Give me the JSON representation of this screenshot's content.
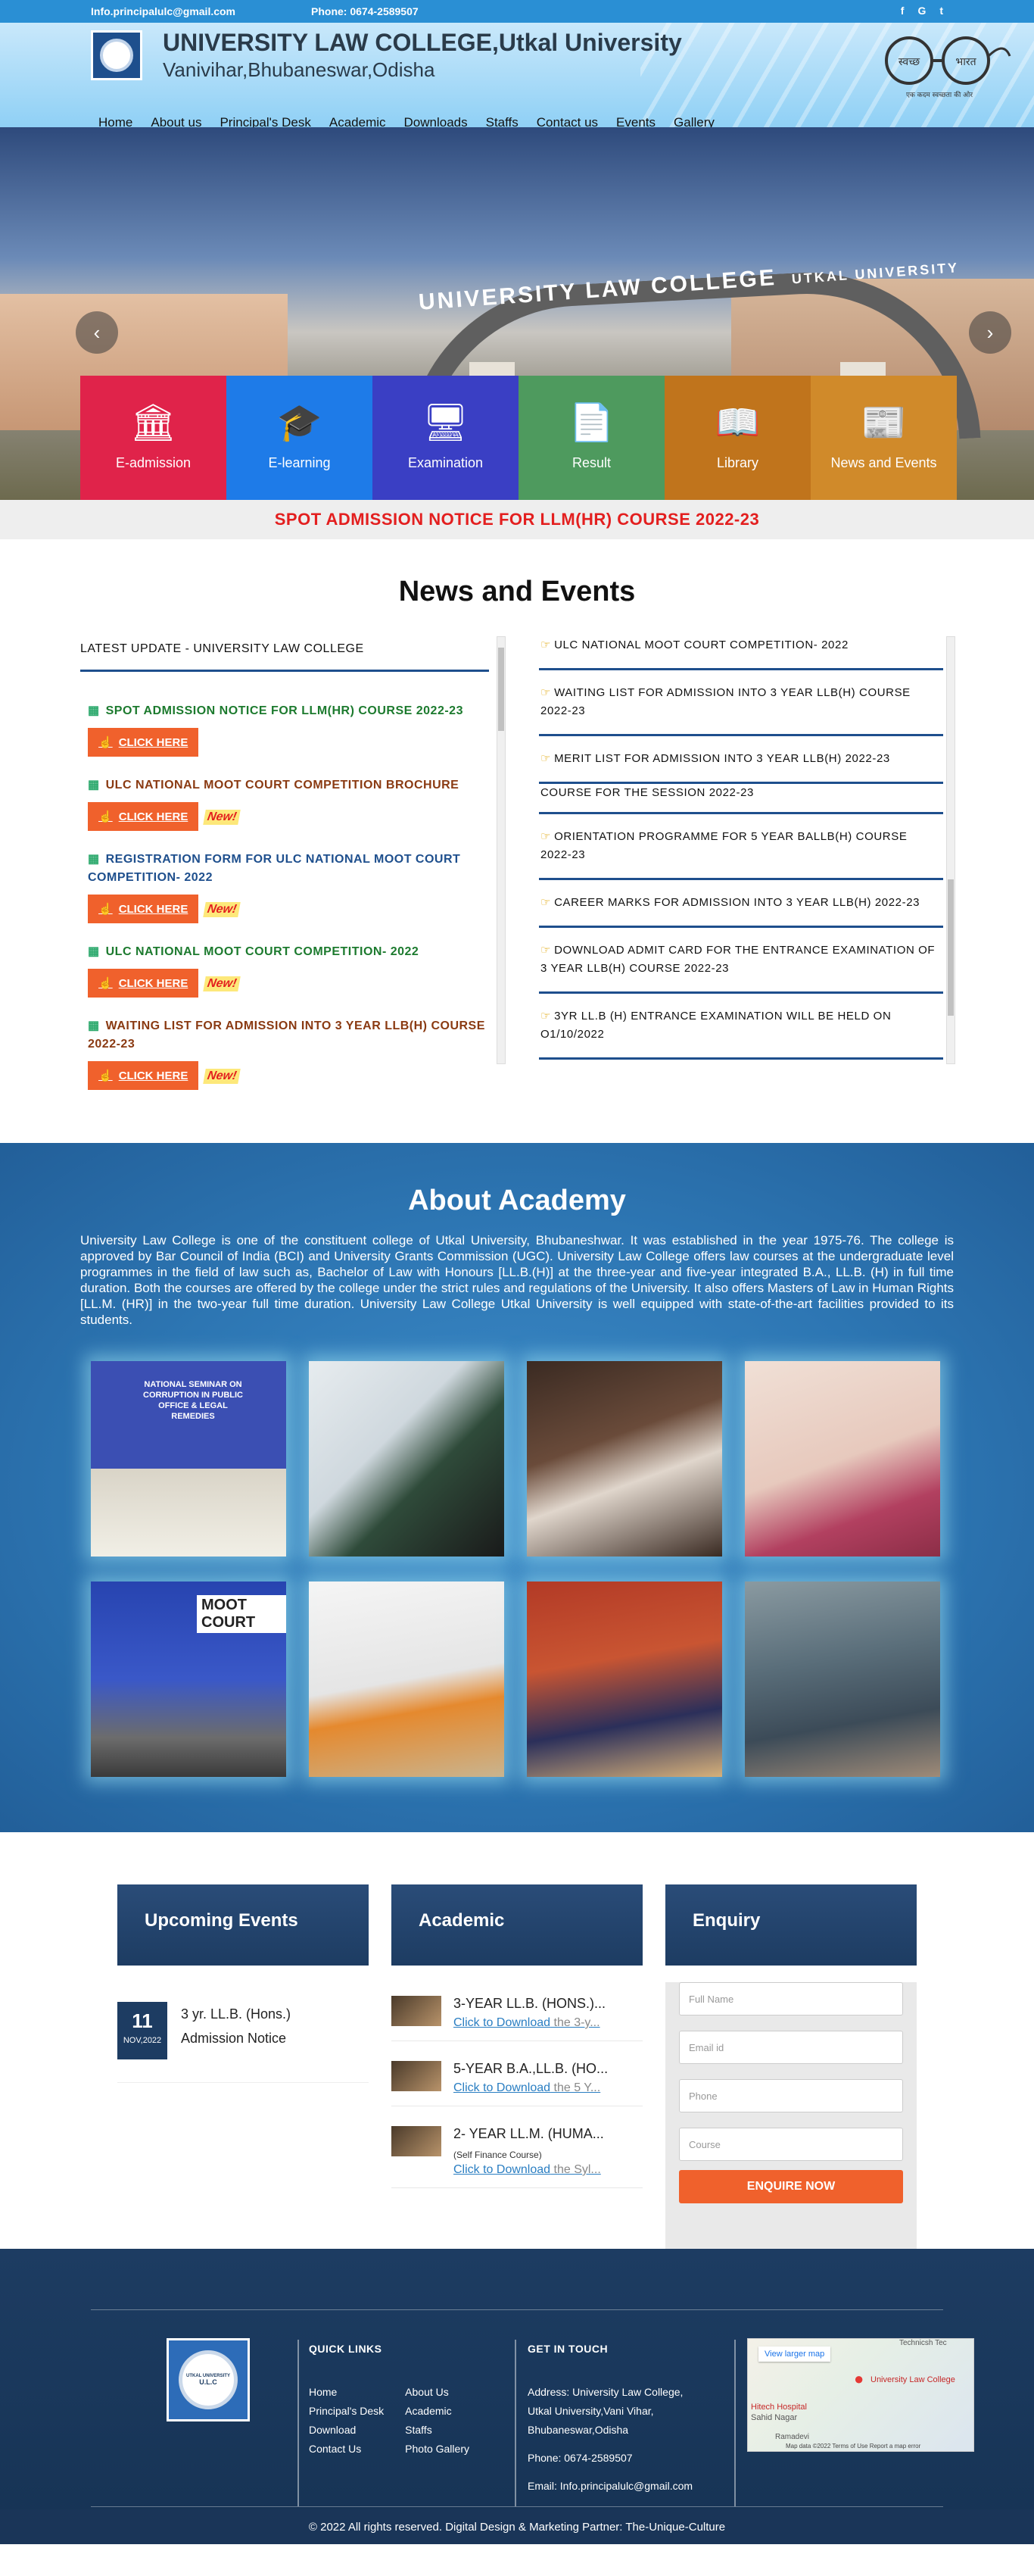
{
  "topbar": {
    "email": "Info.principalulc@gmail.com",
    "phone": "Phone: 0674-2589507",
    "social": [
      "f",
      "G",
      "t"
    ]
  },
  "header": {
    "title": "UNIVERSITY LAW COLLEGE,Utkal University",
    "subtitle": "Vanivihar,Bhubaneswar,Odisha",
    "swachh_text": [
      "स्वच्छ",
      "भारत",
      "एक कदम स्वच्छता की ओर"
    ],
    "nav": [
      "Home",
      "About us",
      "Principal's Desk",
      "Academic",
      "Downloads",
      "Staffs",
      "Contact us",
      "Events",
      "Gallery"
    ]
  },
  "hero": {
    "arch_text": "UNIVERSITY LAW COLLEGE",
    "arch_sub": "UTKAL UNIVERSITY",
    "tiles": [
      {
        "label": "E-admission",
        "icon": "bank-icon",
        "color": "#e0234a"
      },
      {
        "label": "E-learning",
        "icon": "graduation-cap-icon",
        "color": "#1e7be8"
      },
      {
        "label": "Examination",
        "icon": "monitor-icon",
        "color": "#3a3fc4"
      },
      {
        "label": "Result",
        "icon": "document-icon",
        "color": "#4e9a5e"
      },
      {
        "label": "Library",
        "icon": "book-icon",
        "color": "#c0741c"
      },
      {
        "label": "News and Events",
        "icon": "newspaper-icon",
        "color": "#d08a2a"
      }
    ]
  },
  "notice": "SPOT ADMISSION NOTICE FOR LLM(HR) COURSE 2022-23",
  "news": {
    "heading": "News and Events",
    "latest_label": "LATEST UPDATE - UNIVERSITY LAW COLLEGE",
    "click": "CLICK HERE",
    "new_badge": "New!",
    "left_items": [
      {
        "title": "SPOT ADMISSION NOTICE FOR LLM(HR) COURSE 2022-23",
        "color": "#1c7a2e",
        "new": false
      },
      {
        "title": "ULC NATIONAL MOOT COURT COMPETITION BROCHURE",
        "color": "#8a3a12",
        "new": true
      },
      {
        "title": "REGISTRATION FORM FOR ULC NATIONAL MOOT COURT COMPETITION- 2022",
        "color": "#1e4f8d",
        "new": true
      },
      {
        "title": "ULC NATIONAL MOOT COURT COMPETITION- 2022",
        "color": "#1c7a2e",
        "new": true
      },
      {
        "title": "WAITING LIST FOR ADMISSION INTO 3 YEAR LLB(H) COURSE 2022-23",
        "color": "#8a3a12",
        "new": true
      }
    ],
    "right_items": [
      "ULC NATIONAL MOOT COURT COMPETITION- 2022",
      "WAITING LIST FOR ADMISSION INTO 3 YEAR LLB(H) COURSE 2022-23",
      "MERIT LIST FOR ADMISSION INTO 3 YEAR LLB(H) 2022-23",
      "COURSE FOR THE SESSION 2022-23",
      "ORIENTATION PROGRAMME FOR 5 YEAR BALLB(H) COURSE 2022-23",
      "CAREER MARKS FOR ADMISSION INTO 3 YEAR LLB(H) 2022-23",
      "DOWNLOAD ADMIT CARD FOR THE ENTRANCE EXAMINATION OF 3 YEAR LLB(H) COURSE 2022-23",
      "3YR LL.B (H) ENTRANCE EXAMINATION WILL BE HELD ON O1/10/2022"
    ]
  },
  "about": {
    "heading": "About Academy",
    "text": "University Law College is one of the constituent college of Utkal University, Bhubaneshwar. It was established in the year 1975-76. The college is approved by Bar Council of India (BCI) and University Grants Commission (UGC). University Law College offers law courses at the undergraduate level programmes in the field of law such as, Bachelor of Law with Honours [LL.B.(H)] at the three-year and five-year integrated B.A., LL.B. (H) in full time duration. Both the courses are offered by the college under the strict rules and regulations of the University. It also offers Masters of Law in Human Rights [LL.M. (HR)] in the two-year full time duration. University Law College Utkal University is well equipped with state-of-the-art facilities provided to its students.",
    "photos": [
      {
        "caption": "NATIONAL SEMINAR ON CORRUPTION IN PUBLIC OFFICE & LEGAL REMEDIES"
      },
      {
        "caption": ""
      },
      {
        "caption": ""
      },
      {
        "caption": ""
      },
      {
        "caption": "MOOT COURT"
      },
      {
        "caption": ""
      },
      {
        "caption": ""
      },
      {
        "caption": ""
      }
    ]
  },
  "events": {
    "heading": "Upcoming Events",
    "day": "11",
    "month": "NOV,2022",
    "line1": "3 yr. LL.B. (Hons.)",
    "line2": "Admission Notice"
  },
  "academic": {
    "heading": "Academic",
    "link_text": "Click to  Download",
    "items": [
      {
        "title": "3-YEAR LL.B. (HONS.)...",
        "sub": "",
        "rest": " the 3-y..."
      },
      {
        "title": "5-YEAR B.A.,LL.B. (HO...",
        "sub": "",
        "rest": " the 5 Y..."
      },
      {
        "title": "2- YEAR LL.M. (HUMA...",
        "sub": "(Self Finance Course)",
        "rest": " the Syl..."
      }
    ]
  },
  "enquiry": {
    "heading": "Enquiry",
    "fields": [
      "Full Name",
      "Email id",
      "Phone",
      "Course"
    ],
    "button": "ENQUIRE NOW"
  },
  "footer": {
    "quick_links_title": "QUICK LINKS",
    "links_col1": [
      "Home",
      "Principal's Desk",
      "Download",
      "Contact Us"
    ],
    "links_col2": [
      "About Us",
      "Academic",
      "Staffs",
      "Photo Gallery"
    ],
    "touch_title": "GET IN TOUCH",
    "address": [
      "Address: University Law College,",
      "Utkal University,Vani Vihar,",
      "Bhubaneswar,Odisha"
    ],
    "phone": "Phone: 0674-2589507",
    "email": "Email: Info.principalulc@gmail.com",
    "map_link": "View larger map",
    "map_pin": "University Law College",
    "map_labels": [
      "Technicsh Tec",
      "Hitech Hospital",
      "Sahid Nagar",
      "Ramadevi"
    ],
    "map_footer": "Map data ©2022   Terms of Use   Report a map error",
    "logo_text": "UTKAL UNIVERSITY",
    "logo_sub": "U.L.C",
    "copyright": "© 2022 All rights reserved. Digital Design & Marketing Partner: The-Unique-Culture"
  },
  "colors": {
    "accent": "#2a8fd4",
    "navy": "#1d3c62",
    "orange": "#f0612c",
    "red": "#e31f1f"
  }
}
